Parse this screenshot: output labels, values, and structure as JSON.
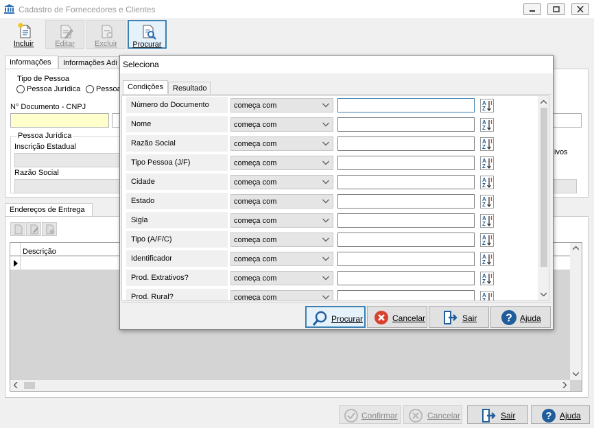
{
  "window": {
    "title": "Cadastro de Fornecedores e Clientes"
  },
  "toolbar": {
    "incluir": "Incluir",
    "editar": "Editar",
    "excluir": "Excluir",
    "procurar": "Procurar"
  },
  "form": {
    "tabs": [
      "Informações",
      "Informações Adi"
    ],
    "tipo_pessoa_label": "Tipo de Pessoa",
    "radio_juridica": "Pessoa Jurídica",
    "radio_fisica_partial": "Pessoa",
    "documento_label": "N° Documento - CNPJ",
    "pj_group": "Pessoa Jurídica",
    "inscricao_label": "Inscrição Estadual",
    "razao_label": "Razão Social",
    "right_partial_label": "ivos",
    "enderecos_tab": "Endereços de Entrega",
    "grid_col_descricao": "Descrição"
  },
  "bottom": {
    "confirmar": "Confirmar",
    "cancelar": "Cancelar",
    "sair": "Sair",
    "ajuda": "Ajuda"
  },
  "dialog": {
    "title": "Seleciona",
    "tabs": [
      "Condições",
      "Resultado"
    ],
    "rows": [
      {
        "field": "Número do Documento",
        "op": "começa com",
        "value": ""
      },
      {
        "field": "Nome",
        "op": "começa com",
        "value": ""
      },
      {
        "field": "Razão Social",
        "op": "começa com",
        "value": ""
      },
      {
        "field": "Tipo Pessoa (J/F)",
        "op": "começa com",
        "value": ""
      },
      {
        "field": "Cidade",
        "op": "começa com",
        "value": ""
      },
      {
        "field": "Estado",
        "op": "começa com",
        "value": ""
      },
      {
        "field": "Sigla",
        "op": "começa com",
        "value": ""
      },
      {
        "field": "Tipo (A/F/C)",
        "op": "começa com",
        "value": ""
      },
      {
        "field": "Identificador",
        "op": "começa com",
        "value": ""
      },
      {
        "field": "Prod. Extrativos?",
        "op": "começa com",
        "value": ""
      },
      {
        "field": "Prod. Rural?",
        "op": "começa com",
        "value": ""
      }
    ],
    "buttons": {
      "procurar": "Procurar",
      "cancelar": "Cancelar",
      "sair": "Sair",
      "ajuda": "Ajuda"
    }
  },
  "colors": {
    "accent": "#3c7fb1",
    "danger": "#d9412f",
    "help": "#1f5d9c",
    "required_field": "#ffffcc"
  }
}
